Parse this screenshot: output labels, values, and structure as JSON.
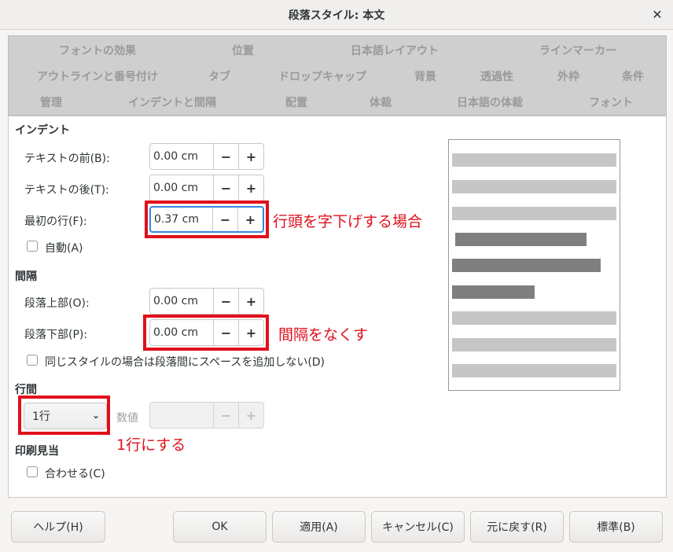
{
  "window": {
    "title": "段落スタイル: 本文"
  },
  "tabs": [
    {
      "label": "フォントの効果"
    },
    {
      "label": "位置"
    },
    {
      "label": "日本語レイアウト"
    },
    {
      "label": "ラインマーカー"
    },
    {
      "label": "アウトラインと番号付け"
    },
    {
      "label": "タブ"
    },
    {
      "label": "ドロップキャップ"
    },
    {
      "label": "背景"
    },
    {
      "label": "透過性"
    },
    {
      "label": "外枠"
    },
    {
      "label": "条件"
    },
    {
      "label": "管理"
    },
    {
      "label": "インデントと間隔"
    },
    {
      "label": "配置"
    },
    {
      "label": "体裁"
    },
    {
      "label": "日本語の体裁"
    },
    {
      "label": "フォント"
    }
  ],
  "indent": {
    "heading": "インデント",
    "before_label": "テキストの前(B):",
    "before_value": "0.00 cm",
    "after_label": "テキストの後(T):",
    "after_value": "0.00 cm",
    "first_label": "最初の行(F):",
    "first_value": "0.37 cm",
    "auto_label": "自動(A)"
  },
  "spacing": {
    "heading": "間隔",
    "above_label": "段落上部(O):",
    "above_value": "0.00 cm",
    "below_label": "段落下部(P):",
    "below_value": "0.00 cm",
    "same_style_label": "同じスタイルの場合は段落間にスペースを追加しない(D)"
  },
  "line_spacing": {
    "heading": "行間",
    "selected": "1行",
    "value_label": "数値",
    "value": ""
  },
  "register": {
    "heading": "印刷見当",
    "activate_label": "合わせる(C)"
  },
  "spin_symbols": {
    "minus": "−",
    "plus": "+"
  },
  "annotations": {
    "first_line": "行頭を字下げする場合",
    "spacing_below": "間隔をなくす",
    "line_spacing": "1行にする"
  },
  "buttons": {
    "help": "ヘルプ(H)",
    "ok": "OK",
    "apply": "適用(A)",
    "cancel": "キャンセル(C)",
    "reset": "元に戻す(R)",
    "standard": "標準(B)"
  },
  "colors": {
    "annotation": "#e0101b",
    "focus": "#3584e4"
  }
}
